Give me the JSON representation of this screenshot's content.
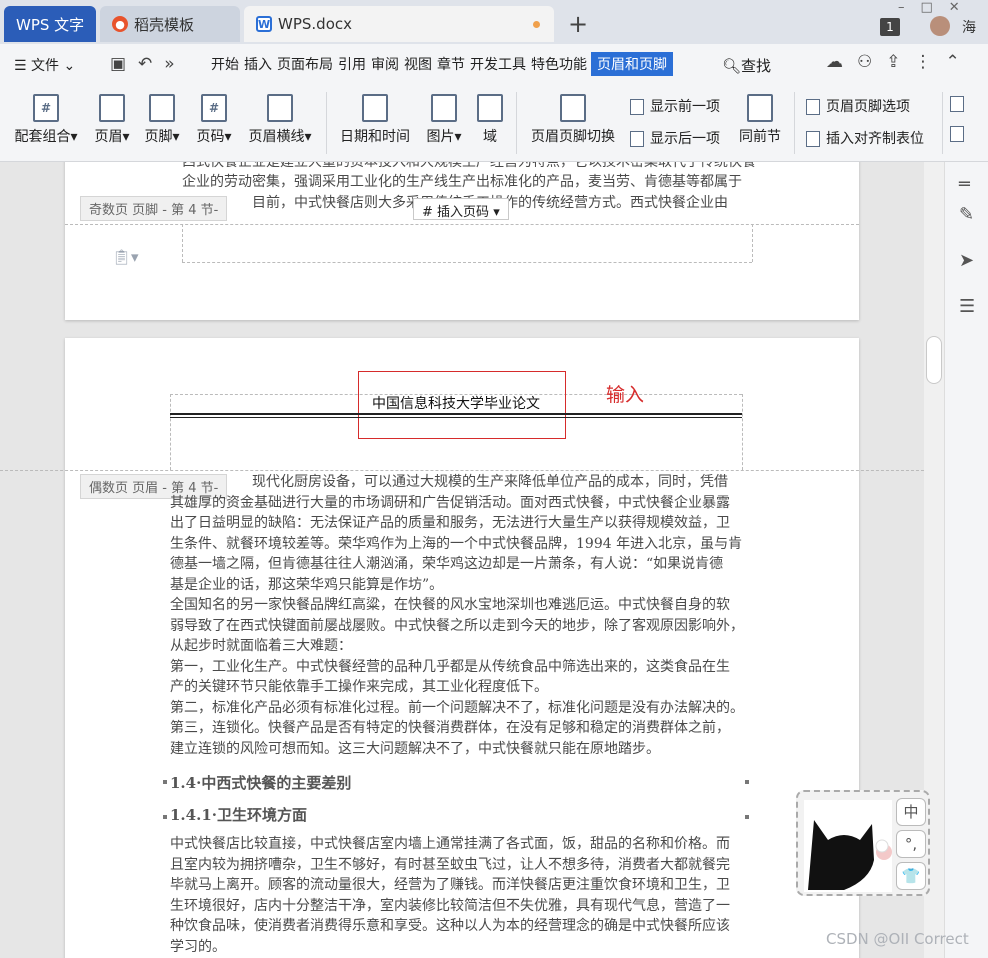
{
  "tabs": {
    "wps": "WPS 文字",
    "daoke": "稻壳模板",
    "doc": "WPS.docx",
    "win_count": "1",
    "user": "海"
  },
  "menu": {
    "file": "☰ 文件 ⌄",
    "items": [
      "开始",
      "插入",
      "页面布局",
      "引用",
      "审阅",
      "视图",
      "章节",
      "开发工具",
      "特色功能",
      "页眉和页脚"
    ],
    "search": "查找"
  },
  "ribbon": {
    "combo": "配套组合",
    "header": "页眉",
    "footer": "页脚",
    "page_num": "页码",
    "header_line": "页眉横线",
    "date_time": "日期和时间",
    "image": "图片",
    "field": "域",
    "switch": "页眉页脚切换",
    "show_prev": "显示前一项",
    "show_next": "显示后一项",
    "same_prev": "同前节",
    "options": "页眉页脚选项",
    "insert_tab": "插入对齐制表位"
  },
  "page1": {
    "lines": [
      "西式快餐企业是建立大量的资本投入和大规模生产经营为特点，它以技术密集取代了传统快餐",
      "企业的劳动密集，强调采用工业化的生产线生产出标准化的产品，麦当劳、肯德基等都属于",
      "目前，中式快餐店则大多采用传统手工操作的传统经营方式。西式快餐企业由"
    ],
    "footer_label": "奇数页 页脚",
    "footer_page": "- 第 4 节-",
    "insert_pagenum": "插入页码"
  },
  "page2": {
    "header_text": "中国信息科技大学毕业论文",
    "note": "输入",
    "header_label": "偶数页 页眉",
    "header_page": "- 第 4 节-",
    "lines": [
      "现代化厨房设备，可以通过大规模的生产来降低单位产品的成本，同时，凭借",
      "其雄厚的资金基础进行大量的市场调研和广告促销活动。面对西式快餐，中式快餐企业暴露",
      "出了日益明显的缺陷：无法保证产品的质量和服务，无法进行大量生产以获得规模效益，卫",
      "生条件、就餐环境较差等。荣华鸡作为上海的一个中式快餐品牌，1994 年进入北京，虽与肯",
      "德基一墙之隔，但肯德基往往人潮汹涌，荣华鸡这边却是一片萧条，有人说：“如果说肯德",
      "基是企业的话，那这荣华鸡只能算是作坊”。",
      "全国知名的另一家快餐品牌红高粱，在快餐的风水宝地深圳也难逃厄运。中式快餐自身的软",
      "弱导致了在西式快键面前屡战屡败。中式快餐之所以走到今天的地步，除了客观原因影响外，",
      "从起步时就面临着三大难题：",
      "第一，工业化生产。中式快餐经营的品种几乎都是从传统食品中筛选出来的，这类食品在生",
      "产的关键环节只能依靠手工操作来完成，其工业化程度低下。",
      "第二，标准化产品必须有标准化过程。前一个问题解决不了，标准化问题是没有办法解决的。",
      "第三，连锁化。快餐产品是否有特定的快餐消费群体，在没有足够和稳定的消费群体之前，",
      "建立连锁的风险可想而知。这三大问题解决不了，中式快餐就只能在原地踏步。"
    ],
    "heading1": "1.4·中西式快餐的主要差别",
    "heading2": "1.4.1·卫生环境方面",
    "lines2": [
      "中式快餐店比较直接，中式快餐店室内墙上通常挂满了各式面，饭，甜品的名称和价格。而",
      "且室内较为拥挤嘈杂，卫生不够好，有时甚至蚊虫飞过，让人不想多待，消费者大都就餐完",
      "毕就马上离开。顾客的流动量很大，经营为了赚钱。而洋快餐店更注重饮食环境和卫生，卫",
      "生环境很好，店内十分整洁干净，室内装修比较简洁但不失优雅，具有现代气息，营造了一",
      "种饮食品味，使消费者消费得乐意和享受。这种以人为本的经营理念的确是中式快餐所应该",
      "学习的。"
    ]
  },
  "sticker": {
    "btn1": "中",
    "btn2": "°,",
    "btn3": "👕"
  },
  "watermark": "CSDN @OII Correct"
}
